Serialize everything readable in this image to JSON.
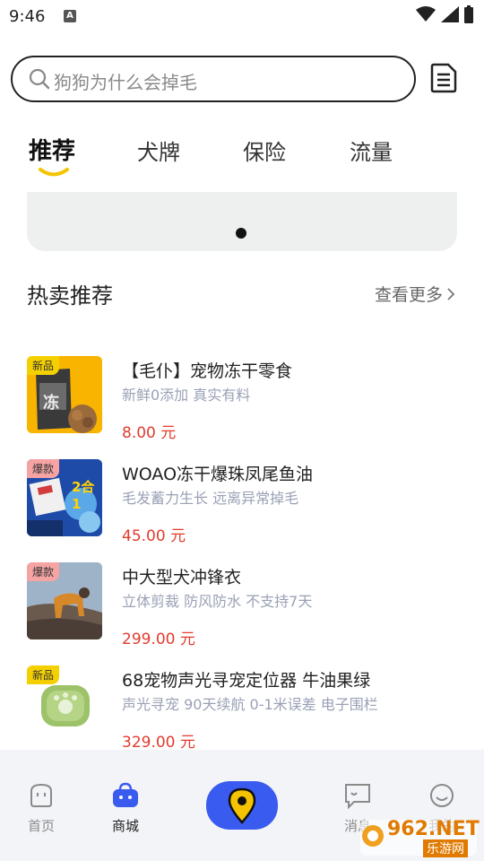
{
  "status_bar": {
    "time": "9:46",
    "notif_glyph": "A"
  },
  "search": {
    "placeholder": "狗狗为什么会掉毛"
  },
  "tabs": [
    {
      "label": "推荐",
      "active": true
    },
    {
      "label": "犬牌",
      "active": false
    },
    {
      "label": "保险",
      "active": false
    },
    {
      "label": "流量",
      "active": false
    }
  ],
  "section": {
    "title": "热卖推荐",
    "more": "查看更多"
  },
  "products": [
    {
      "badge": "新品",
      "title": "【毛仆】宠物冻干零食",
      "subtitle": "新鲜0添加 真实有料",
      "price": "8.00 元",
      "thumb_text": "冻"
    },
    {
      "badge": "爆款",
      "title": "WOAO冻干爆珠凤尾鱼油",
      "subtitle": "毛发蓄力生长 远离异常掉毛",
      "price": "45.00 元",
      "thumb_text": "2合1"
    },
    {
      "badge": "爆款",
      "title": "中大型犬冲锋衣",
      "subtitle": "立体剪裁 防风防水 不支持7天",
      "price": "299.00 元"
    },
    {
      "badge": "新品",
      "title": "68宠物声光寻宠定位器 牛油果绿",
      "subtitle": "声光寻宠 90天续航 0-1米误差 电子围栏",
      "price": "329.00 元"
    }
  ],
  "bottom_nav": [
    {
      "label": "首页",
      "icon": "home-face-icon"
    },
    {
      "label": "商城",
      "icon": "shop-bag-icon",
      "active": true
    },
    {
      "label": "消息",
      "icon": "message-icon"
    },
    {
      "label": "我的",
      "icon": "smile-icon"
    }
  ],
  "watermark": {
    "main": "962.NET",
    "sub": "乐游网"
  },
  "colors": {
    "accent": "#3a5bef",
    "tab_underline": "#f5c400",
    "price": "#e23b2e",
    "badge_new": "#f5d000",
    "badge_hot": "#f5a3a3"
  }
}
